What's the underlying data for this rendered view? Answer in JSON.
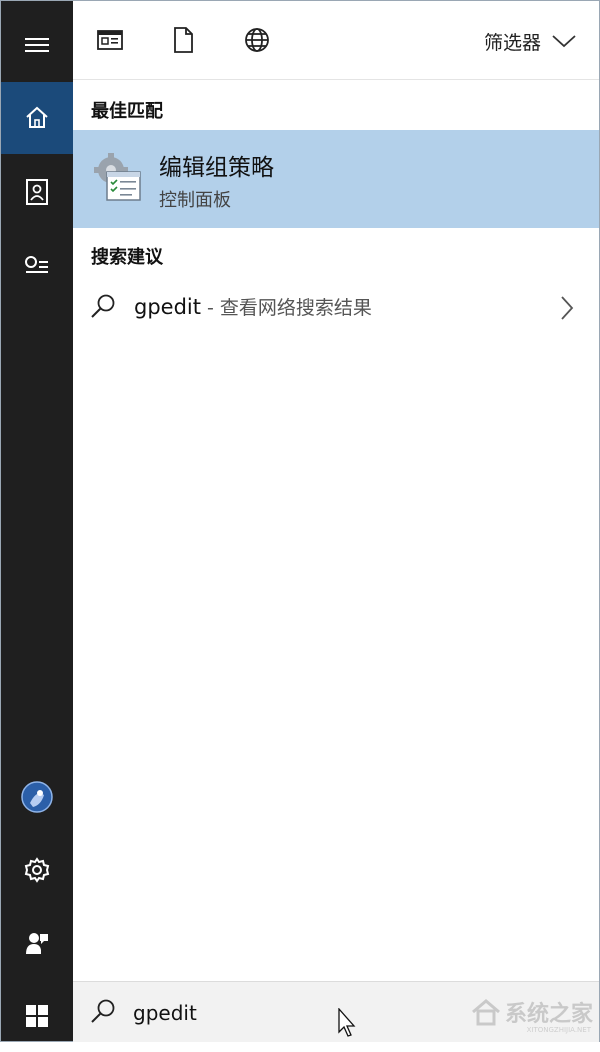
{
  "rail": {
    "items": [
      {
        "name": "menu",
        "icon": "hamburger-icon"
      },
      {
        "name": "home",
        "icon": "home-icon",
        "active": true
      },
      {
        "name": "notebook",
        "icon": "notebook-icon"
      },
      {
        "name": "interests",
        "icon": "interests-icon"
      },
      {
        "name": "account",
        "icon": "avatar"
      },
      {
        "name": "settings",
        "icon": "gear-icon"
      },
      {
        "name": "feedback",
        "icon": "feedback-icon"
      },
      {
        "name": "start",
        "icon": "windows-icon"
      }
    ],
    "colors": {
      "background": "#1f1f1f",
      "active": "#1b4a7a"
    }
  },
  "topbar": {
    "icons": [
      "apps-icon",
      "documents-icon",
      "web-icon"
    ],
    "filter_label": "筛选器"
  },
  "best_match": {
    "heading": "最佳匹配",
    "title": "编辑组策略",
    "subtitle": "控制面板",
    "highlight_color": "#b3d0ea"
  },
  "suggestions": {
    "heading": "搜索建议",
    "items": [
      {
        "query": "gpedit",
        "hint": " - 查看网络搜索结果"
      }
    ]
  },
  "search": {
    "value": "gpedit"
  },
  "watermark": {
    "text": "系统之家",
    "subtext": "XITONGZHIJIA.NET"
  }
}
